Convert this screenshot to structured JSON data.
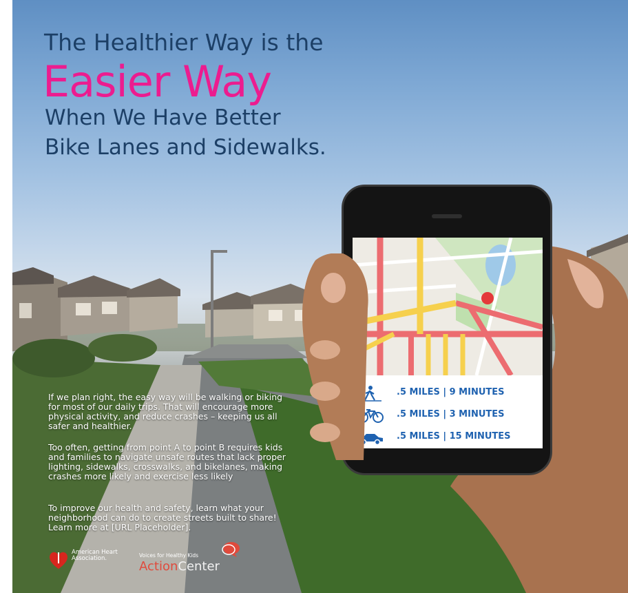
{
  "headline": {
    "line1": "The Healthier Way is the",
    "emphasis": "Easier Way",
    "line3": "When We Have Better",
    "line4": "Bike Lanes and Sidewalks."
  },
  "body": {
    "paragraph1": "If we plan right, the easy way will be walking or biking for most of our daily trips. That will encourage more physical activity, and reduce crashes – keeping us all safer and healthier.",
    "paragraph2": "Too often, getting from point A to point B requires kids and families to navigate unsafe routes that lack proper lighting, sidewalks, crosswalks, and bikelanes, making crashes more likely and exercise less likely",
    "paragraph3": "To improve our health and safety, learn what your neighborhood can do to create streets built to share! Learn more at [URL Placeholder]."
  },
  "phone": {
    "stats": [
      {
        "icon": "walking-icon",
        "text": ".5 MILES | 9 MINUTES"
      },
      {
        "icon": "bicycle-icon",
        "text": ".5 MILES | 3 MINUTES"
      },
      {
        "icon": "car-icon",
        "text": ".5 MILES | 15 MINUTES"
      }
    ]
  },
  "logos": {
    "aha": "American Heart Association.",
    "vhk_tagline": "Voices for Healthy Kids",
    "action": "Action",
    "center": "Center"
  },
  "colors": {
    "headline_navy": "#1c3f66",
    "headline_pink": "#ec1c8f",
    "stat_blue": "#1f62b0",
    "aha_red": "#d7261e"
  }
}
